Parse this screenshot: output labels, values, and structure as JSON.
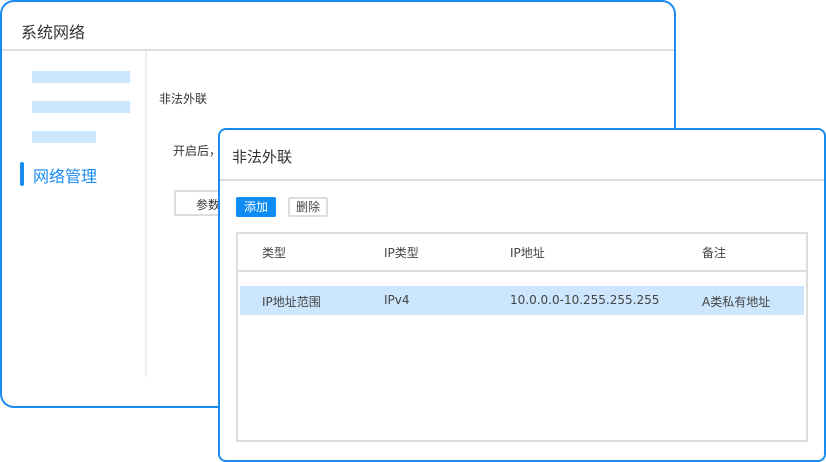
{
  "back_window": {
    "title": "系统网络",
    "nav_active": "网络管理",
    "section_label": "非法外联",
    "desc_prefix": "开启后，",
    "param_button": "参数"
  },
  "dialog": {
    "title": "非法外联",
    "add_button": "添加",
    "delete_button": "删除",
    "columns": [
      "类型",
      "IP类型",
      "IP地址",
      "备注"
    ],
    "rows": [
      {
        "type": "IP地址范围",
        "ip_type": "IPv4",
        "ip": "10.0.0.0-10.255.255.255",
        "note": "A类私有地址",
        "selected": true
      }
    ]
  },
  "colors": {
    "accent": "#1a8cf0",
    "selected_row": "#cce6fd"
  }
}
